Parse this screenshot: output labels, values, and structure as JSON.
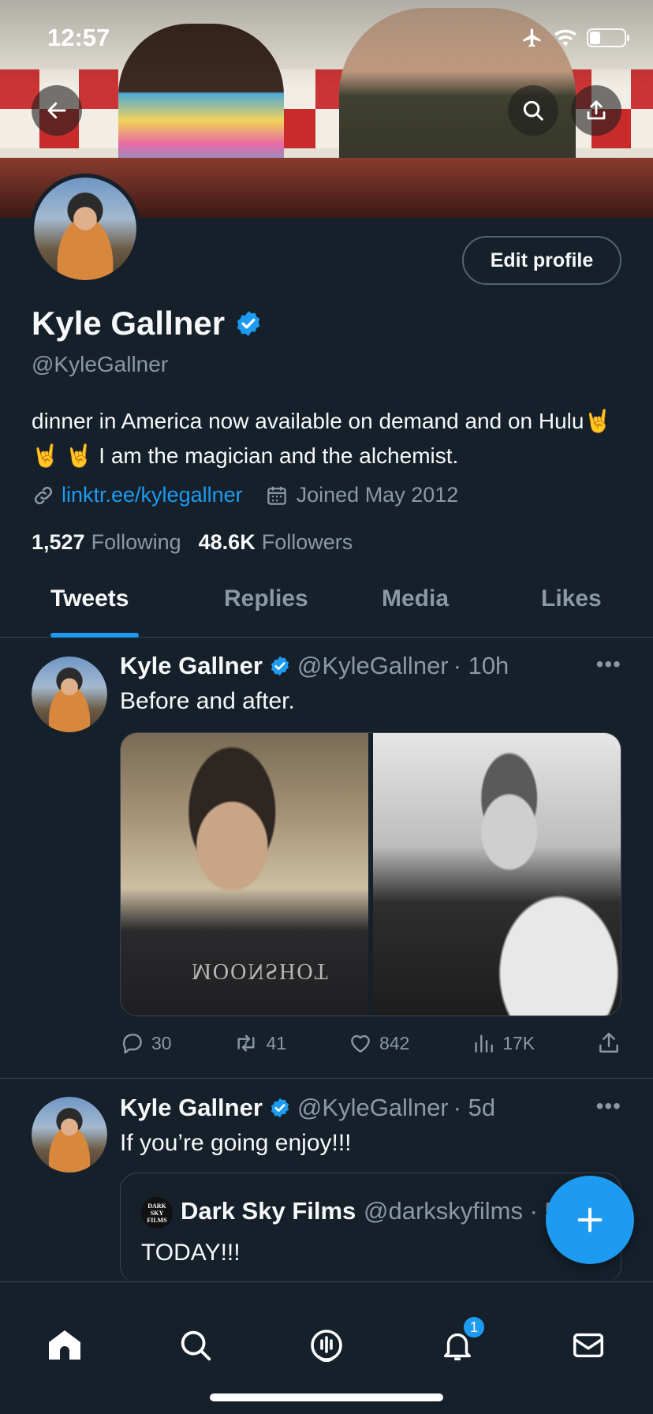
{
  "status_bar": {
    "time": "12:57"
  },
  "profile": {
    "edit_button": "Edit profile",
    "name": "Kyle Gallner",
    "handle": "@KyleGallner",
    "bio": "dinner in America now available on demand and on Hulu🤘 🤘 🤘  I am the magician and the alchemist.",
    "link": "linktr.ee/kylegallner",
    "joined": "Joined May 2012",
    "following_count": "1,527",
    "following_label": "Following",
    "followers_count": "48.6K",
    "followers_label": "Followers"
  },
  "tabs": [
    "Tweets",
    "Replies",
    "Media",
    "Likes"
  ],
  "tweets": [
    {
      "name": "Kyle Gallner",
      "handle": "@KyleGallner",
      "time": "· 10h",
      "text": "Before and after.",
      "media_text": "MOONSHOT",
      "replies": "30",
      "retweets": "41",
      "likes": "842",
      "views": "17K"
    },
    {
      "name": "Kyle Gallner",
      "handle": "@KyleGallner",
      "time": "· 5d",
      "text": "If you’re going enjoy!!!",
      "quote": {
        "avatar_text": "DARK SKY FILMS",
        "name": "Dark Sky Films",
        "handle": "@darkskyfilms · 5",
        "text": "TODAY!!!"
      }
    }
  ],
  "nav": {
    "notifications_badge": "1"
  },
  "colors": {
    "accent": "#1d9bf0",
    "background": "#15202b",
    "secondary_text": "#8b98a5"
  }
}
